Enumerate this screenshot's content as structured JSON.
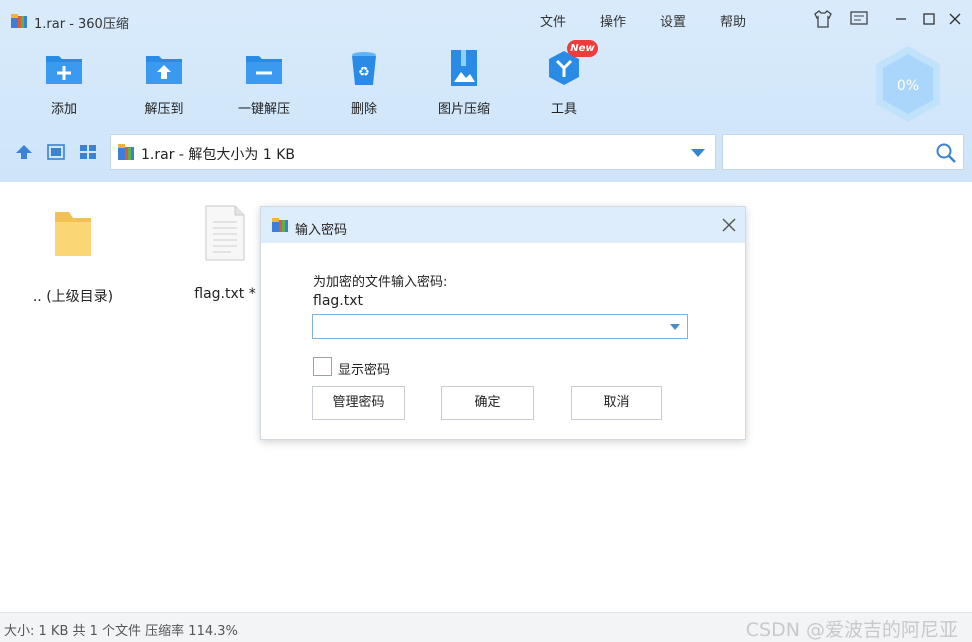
{
  "window": {
    "title": "1.rar - 360压缩",
    "menu": [
      "文件",
      "操作",
      "设置",
      "帮助"
    ]
  },
  "toolbar": {
    "items": [
      {
        "label": "添加",
        "icon": "add-folder-icon"
      },
      {
        "label": "解压到",
        "icon": "extract-to-icon"
      },
      {
        "label": "一键解压",
        "icon": "one-click-extract-icon"
      },
      {
        "label": "删除",
        "icon": "recycle-bin-icon"
      },
      {
        "label": "图片压缩",
        "icon": "image-compress-icon"
      },
      {
        "label": "工具",
        "icon": "tools-icon"
      }
    ],
    "new_badge": "New",
    "progress_label": "0%"
  },
  "address": {
    "text": "1.rar - 解包大小为 1 KB"
  },
  "files": [
    {
      "label": ".. (上级目录)",
      "icon": "folder-icon"
    },
    {
      "label": "flag.txt *",
      "icon": "text-file-icon"
    }
  ],
  "status": {
    "text": "大小: 1 KB 共 1 个文件 压缩率 114.3%",
    "watermark": "CSDN @爱波吉的阿尼亚"
  },
  "dialog": {
    "title": "输入密码",
    "prompt": "为加密的文件输入密码:",
    "filename": "flag.txt",
    "password_value": "",
    "show_password_label": "显示密码",
    "buttons": {
      "manage": "管理密码",
      "ok": "确定",
      "cancel": "取消"
    }
  },
  "colors": {
    "accent": "#2a8be6",
    "header_bg": "#d9ebfb",
    "new_badge": "#ee3b3b"
  }
}
